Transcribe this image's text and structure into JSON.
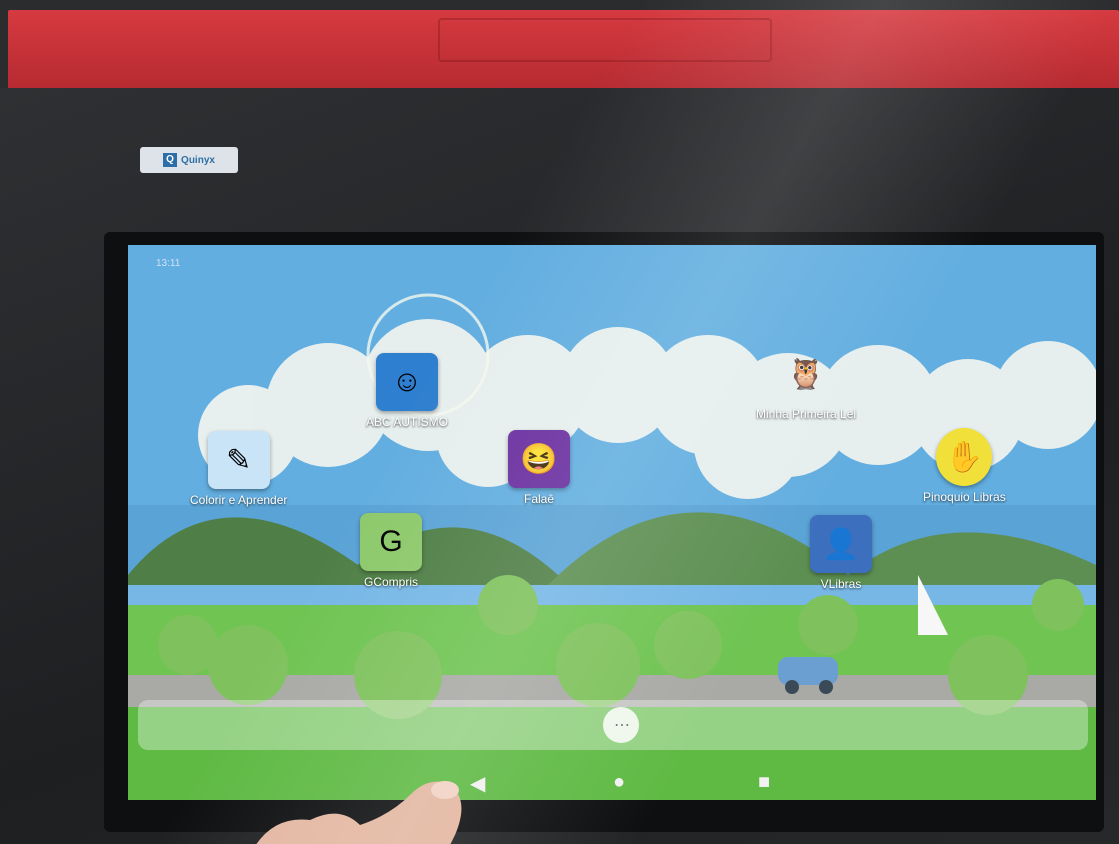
{
  "device": {
    "brand_label": "Quinyx",
    "status_time": "13:11"
  },
  "home_screen": {
    "apps": [
      {
        "label": "ABC AUTISMO",
        "icon": "boy-face-icon",
        "color": "#2f7fd0"
      },
      {
        "label": "Minha Primeira Lei",
        "icon": "owl-character-icon",
        "color": "#8a6b4f"
      },
      {
        "label": "Colorir e Aprender",
        "icon": "coloring-book-icon",
        "color": "#c9e3f7"
      },
      {
        "label": "Falaê",
        "icon": "laughing-face-icon",
        "color": "#6a2fa0"
      },
      {
        "label": "Pinoquio Libras",
        "icon": "sign-language-icon",
        "color": "#f2e03a"
      },
      {
        "label": "GCompris",
        "icon": "gcompris-icon",
        "color": "#8dc96b"
      },
      {
        "label": "VLibras",
        "icon": "vlibras-icon",
        "color": "#3d6fbf"
      }
    ],
    "dock": {
      "all_apps_glyph": "⋯"
    }
  },
  "nav_bar": {
    "back_glyph": "◀",
    "home_glyph": "●",
    "recents_glyph": "■"
  }
}
